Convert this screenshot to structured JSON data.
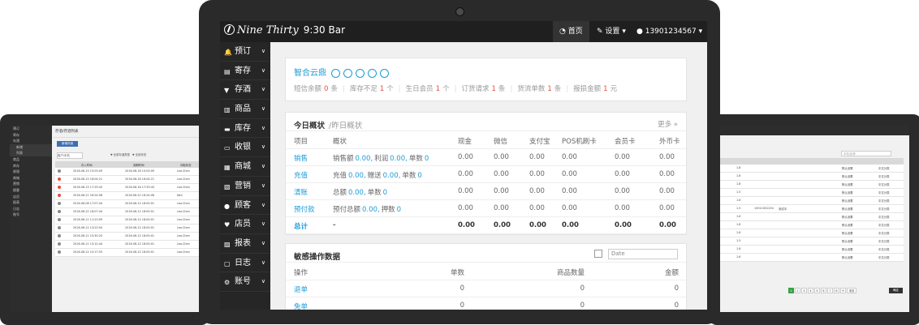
{
  "main": {
    "brand": {
      "logo_text": "Nine Thirty",
      "name": "9:30 Bar"
    },
    "topnav": {
      "home": "首页",
      "settings": "设置",
      "user": "13901234567"
    },
    "sidebar": [
      {
        "label": "预订"
      },
      {
        "label": "寄存"
      },
      {
        "label": "存酒"
      },
      {
        "label": "商品"
      },
      {
        "label": "库存"
      },
      {
        "label": "收银"
      },
      {
        "label": "商城"
      },
      {
        "label": "营销"
      },
      {
        "label": "顾客"
      },
      {
        "label": "店员"
      },
      {
        "label": "报表"
      },
      {
        "label": "日志"
      },
      {
        "label": "账号"
      }
    ],
    "cloud": {
      "title": "智合云鼎",
      "stats": [
        {
          "label": "短信余额",
          "value": "0",
          "unit": "条"
        },
        {
          "label": "库存不足",
          "value": "1",
          "unit": "个"
        },
        {
          "label": "生日会员",
          "value": "1",
          "unit": "个"
        },
        {
          "label": "订货请求",
          "value": "1",
          "unit": "条"
        },
        {
          "label": "货流单数",
          "value": "1",
          "unit": "条"
        },
        {
          "label": "报损金额",
          "value": "1",
          "unit": "元"
        }
      ]
    },
    "overview": {
      "title": "今日概状",
      "alt_title": "昨日概状",
      "more": "更多",
      "columns": [
        "项目",
        "概状",
        "现金",
        "微信",
        "支付宝",
        "POS机刷卡",
        "会员卡",
        "外币卡"
      ],
      "rows": [
        {
          "name": "销售",
          "summary_parts": [
            "销售额",
            "0.00,",
            "利润",
            "0.00,",
            "单数",
            "0"
          ],
          "values": [
            "0.00",
            "0.00",
            "0.00",
            "0.00",
            "0.00",
            "0.00"
          ]
        },
        {
          "name": "充值",
          "summary_parts": [
            "充值",
            "0.00,",
            "赠送",
            "0.00,",
            "单数",
            "0"
          ],
          "values": [
            "0.00",
            "0.00",
            "0.00",
            "0.00",
            "0.00",
            "0.00"
          ]
        },
        {
          "name": "清账",
          "summary_parts": [
            "总额",
            "0.00,",
            "单数",
            "0"
          ],
          "values": [
            "0.00",
            "0.00",
            "0.00",
            "0.00",
            "0.00",
            "0.00"
          ]
        },
        {
          "name": "预付款",
          "summary_parts": [
            "预付总额",
            "0.00,",
            "押数",
            "0"
          ],
          "values": [
            "0.00",
            "0.00",
            "0.00",
            "0.00",
            "0.00",
            "0.00"
          ]
        },
        {
          "name": "总计",
          "summary": "-",
          "values": [
            "0.00",
            "0.00",
            "0.00",
            "0.00",
            "0.00",
            "0.00"
          ]
        }
      ]
    },
    "sensitive": {
      "title": "敏感操作数据",
      "date_placeholder": "Date",
      "columns": [
        "操作",
        "单数",
        "商品数量",
        "金额"
      ],
      "rows": [
        {
          "name": "退单",
          "count": "0",
          "qty": "0",
          "amount": "0"
        },
        {
          "name": "免单",
          "count": "0",
          "qty": "0",
          "amount": "0"
        }
      ]
    }
  },
  "left_screen": {
    "page_title": "存酒/存酒列表",
    "add_button": "新增存酒",
    "search_placeholder": "客户/手机",
    "filters": [
      "▼ 全部存酒类型",
      "▼ 全部状态"
    ],
    "columns": [
      "存入时间",
      "到期时间",
      "存取状态"
    ],
    "menu": [
      "预订",
      "寄存",
      "存酒",
      "新增",
      "列表",
      "商品",
      "库存",
      "收银",
      "商城",
      "营销",
      "顾客",
      "店员",
      "报表",
      "日志",
      "账号"
    ],
    "rows": [
      {
        "status": "gray",
        "in": "2016-06-15 15:03:09",
        "due": "2016-06-16 15:03:09",
        "by": "Leo.Chen"
      },
      {
        "status": "red",
        "in": "2016-06-15 16:04:21",
        "due": "2016-06-16 16:04:21",
        "by": "Leo.Chen"
      },
      {
        "status": "red",
        "in": "2016-06-15 17:29:43",
        "due": "2016-06-16 17:29:43",
        "by": "Leo.Chen"
      },
      {
        "status": "red",
        "in": "2016-06-21 16:24:08",
        "due": "2016-06-22 16:24:08",
        "by": "Neil"
      },
      {
        "status": "gray",
        "in": "2016-06-08 17:07:44",
        "due": "2016-06-12 18:00:01",
        "by": "Leo.Chen"
      },
      {
        "status": "gray",
        "in": "2016-06-22 18:07:44",
        "due": "2016-06-12 18:00:01",
        "by": "Leo.Chen"
      },
      {
        "status": "gray",
        "in": "2016-06-11 11:23:09",
        "due": "2016-06-12 18:00:01",
        "by": "Leo.Chen"
      },
      {
        "status": "gray",
        "in": "2016-06-12 13:23:04",
        "due": "2016-06-12 18:00:01",
        "by": "Leo.Chen"
      },
      {
        "status": "gray",
        "in": "2016-06-11 15:30:20",
        "due": "2016-06-12 18:00:01",
        "by": "Leo.Chen"
      },
      {
        "status": "gray",
        "in": "2016-06-11 13:12:44",
        "due": "2016-06-12 18:00:01",
        "by": "Leo.Chen"
      },
      {
        "status": "gray",
        "in": "2016-06-12 15:17:53",
        "due": "2016-06-12 18:00:01",
        "by": "Leo.Chen"
      }
    ]
  },
  "right_screen": {
    "search_placeholder": "手机/名称",
    "go_button": "确定",
    "pages": [
      "1",
      "2",
      "3",
      "4",
      "5",
      "6",
      "7",
      "8",
      "9",
      "末页"
    ],
    "rows": [
      [
        "1.8",
        "",
        "",
        "",
        "默认设置",
        "中文分类"
      ],
      [
        "1.6",
        "",
        "",
        "",
        "默认设置",
        "中文分类"
      ],
      [
        "1.8",
        "",
        "",
        "",
        "默认设置",
        "中文分类"
      ],
      [
        "1.5",
        "",
        "",
        "",
        "默认设置",
        "中文分类"
      ],
      [
        "1.6",
        "",
        "",
        "",
        "默认设置",
        "中文分类"
      ],
      [
        "1.5",
        "13011001234",
        "测试中",
        "",
        "默认设置",
        "中文分类"
      ],
      [
        "1.6",
        "",
        "",
        "",
        "默认设置",
        "中文分类"
      ],
      [
        "1.8",
        "",
        "",
        "",
        "默认设置",
        "中文分类"
      ],
      [
        "1.6",
        "",
        "",
        "",
        "默认设置",
        "中文分类"
      ],
      [
        "1.5",
        "",
        "",
        "",
        "默认设置",
        "中文分类"
      ],
      [
        "1.8",
        "",
        "",
        "",
        "默认设置",
        "中文分类"
      ],
      [
        "1.6",
        "",
        "",
        "",
        "默认设置",
        "中文分类"
      ]
    ]
  },
  "colors": {
    "accent": "#1b9bd7",
    "alert": "#e84c3d",
    "sidebar": "#262626",
    "topbar": "#1f1f1f",
    "bezel": "#2a2a2a"
  }
}
